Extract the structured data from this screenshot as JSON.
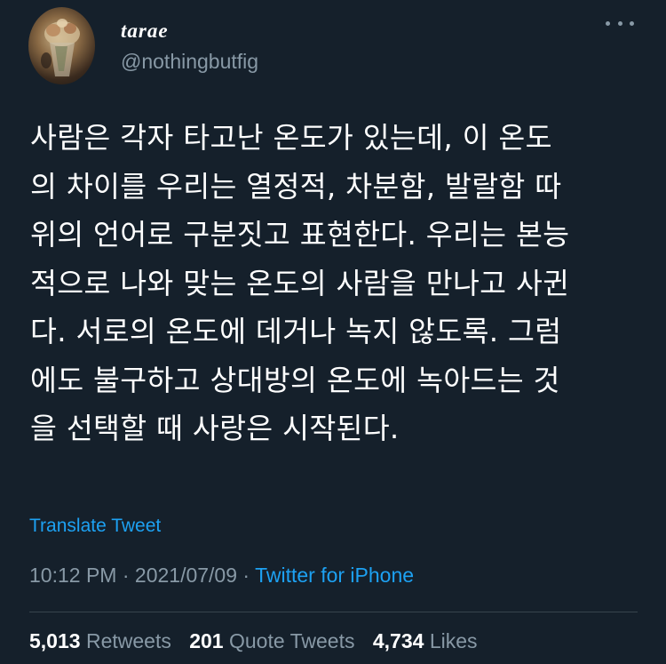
{
  "user": {
    "display_name": "tarae",
    "handle": "@nothingbutfig"
  },
  "icons": {
    "more": "more-horizontal-icon"
  },
  "tweet": {
    "text": "사람은 각자 타고난 온도가 있는데, 이 온도\n의 차이를 우리는 열정적, 차분함, 발랄함 따\n위의 언어로 구분짓고 표현한다. 우리는 본능\n적으로 나와 맞는 온도의 사람을 만나고 사귄\n다. 서로의 온도에 데거나 녹지 않도록. 그럼\n에도 불구하고 상대방의 온도에 녹아드는 것\n을 선택할 때 사랑은 시작된다.",
    "translate_label": "Translate Tweet",
    "time": "10:12 PM",
    "separator": "·",
    "date": "2021/07/09",
    "source": "Twitter for iPhone"
  },
  "stats": {
    "retweets_count": "5,013",
    "retweets_label": "Retweets",
    "quotes_count": "201",
    "quotes_label": "Quote Tweets",
    "likes_count": "4,734",
    "likes_label": "Likes"
  },
  "colors": {
    "background": "#15202b",
    "accent": "#1da1f2",
    "secondary_text": "#8899a6",
    "divider": "#38444d"
  }
}
